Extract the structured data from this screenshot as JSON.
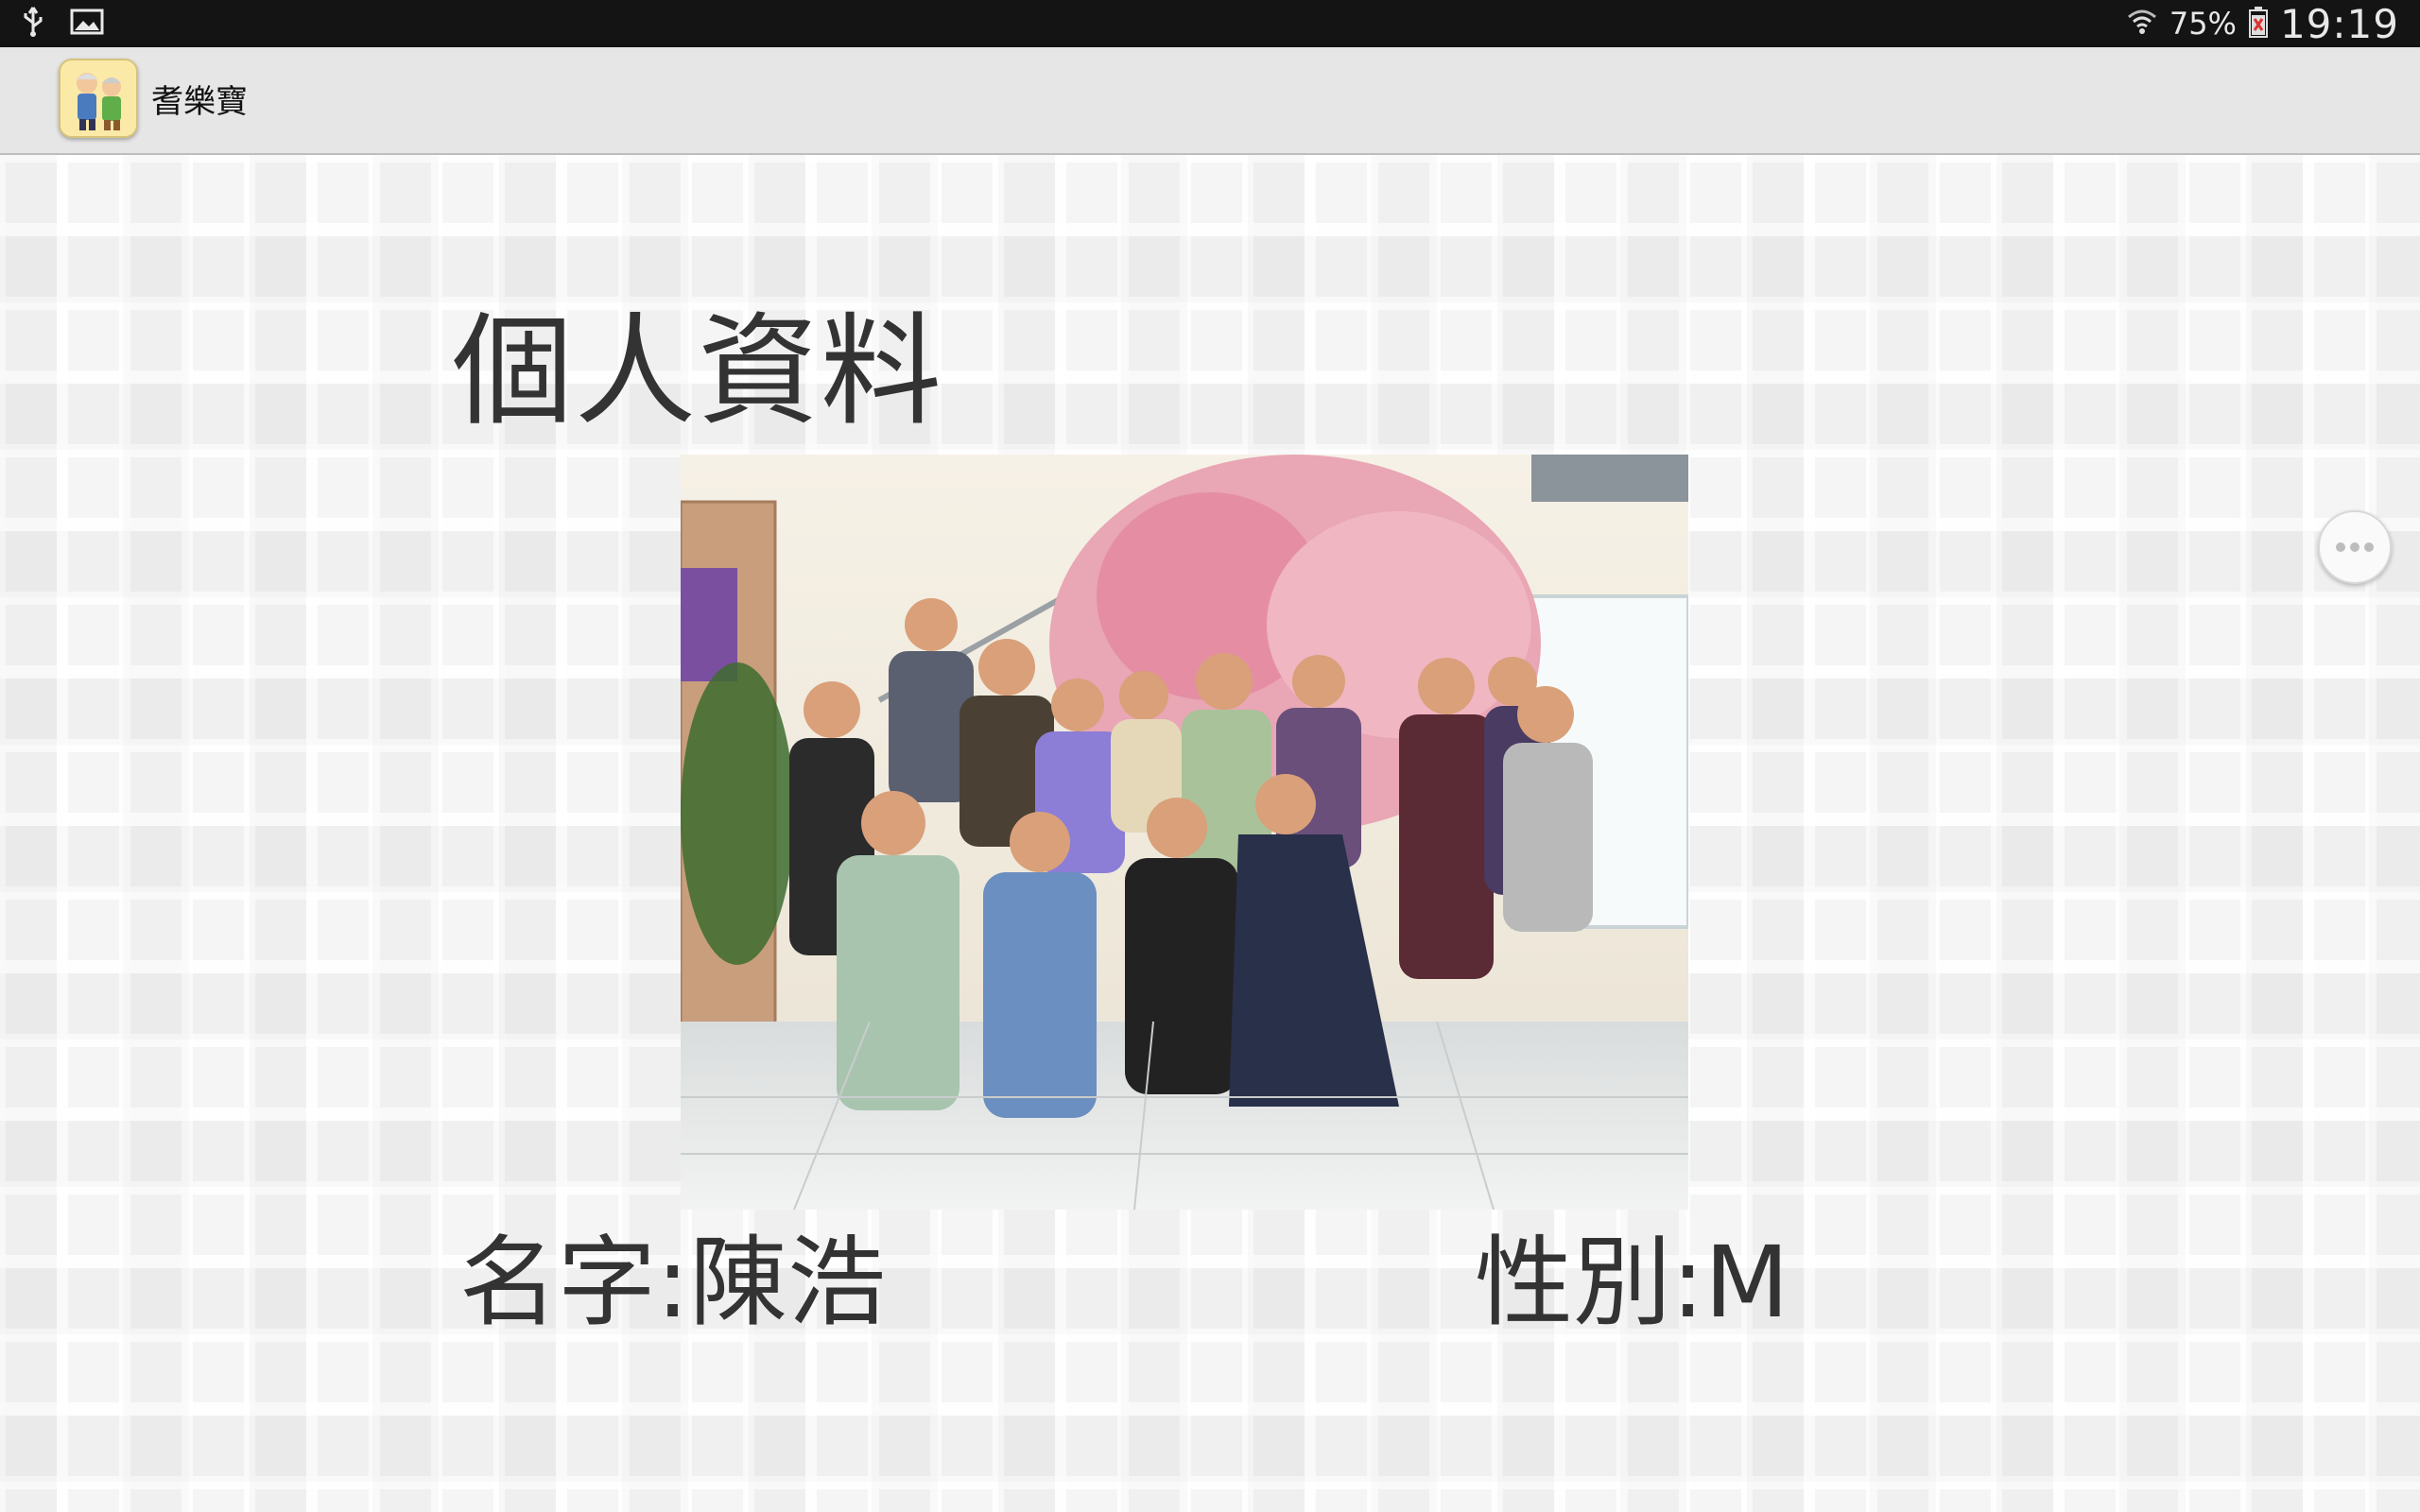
{
  "status_bar": {
    "icons_left": [
      "usb-icon",
      "image-icon"
    ],
    "battery_percent": "75%",
    "time": "19:19",
    "icons_right": [
      "wifi-icon",
      "battery-icon"
    ]
  },
  "app": {
    "title": "耆樂寶",
    "icon": "elderly-couple-app-icon"
  },
  "page": {
    "title": "個人資料",
    "photo_alt": "profile-group-photo",
    "name_label": "名字:陳浩",
    "gender_label": "性別:M"
  },
  "floating": {
    "more_icon": "more-dots-icon"
  }
}
